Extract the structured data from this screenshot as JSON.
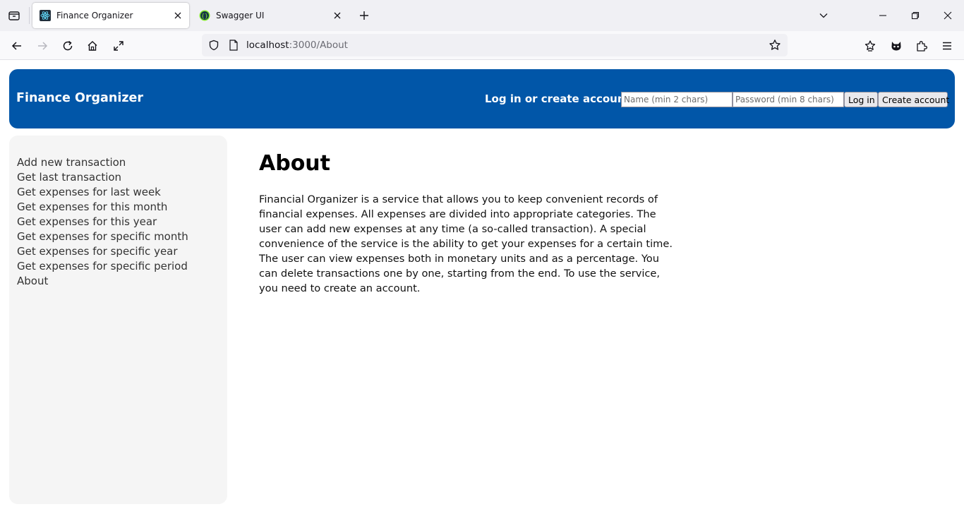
{
  "browser": {
    "tabs": [
      {
        "title": "Finance Organizer",
        "active": true,
        "icon": "react-icon"
      },
      {
        "title": "Swagger UI",
        "active": false,
        "icon": "swagger-icon"
      }
    ],
    "url": {
      "host": "localhost",
      "rest": ":3000/About"
    }
  },
  "header": {
    "title": "Finance Organizer",
    "login_prompt": "Log in or create account",
    "name_placeholder": "Name (min 2 chars)",
    "password_placeholder": "Password (min 8 chars)",
    "login_button": "Log in",
    "create_button": "Create account"
  },
  "sidebar": {
    "items": [
      {
        "label": "Add new transaction"
      },
      {
        "label": "Get last transaction"
      },
      {
        "label": "Get expenses for last week"
      },
      {
        "label": "Get expenses for this month"
      },
      {
        "label": "Get expenses for this year"
      },
      {
        "label": "Get expenses for specific month"
      },
      {
        "label": "Get expenses for specific year"
      },
      {
        "label": "Get expenses for specific period"
      },
      {
        "label": "About"
      }
    ]
  },
  "main": {
    "heading": "About",
    "body": "Financial Organizer is a service that allows you to keep convenient records of financial expenses. All expenses are divided into appropriate categories. The user can add new expenses at any time (a so-called transaction). A special convenience of the service is the ability to get your expenses for a certain time. The user can view expenses both in monetary units and as a percentage. You can delete transactions one by one, starting from the end. To use the service, you need to create an account."
  },
  "colors": {
    "header_bg": "#0156a8",
    "sidebar_bg": "#f5f5f5"
  }
}
